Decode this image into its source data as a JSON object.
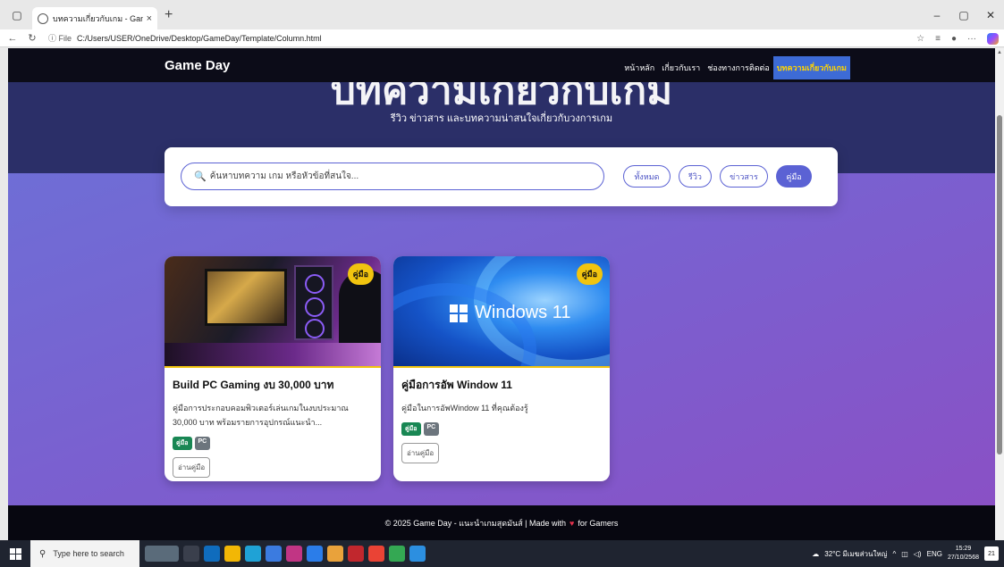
{
  "browser": {
    "tab_title": "บทความเกี่ยวกับเกม - Game Day",
    "tab_close": "×",
    "new_tab": "+",
    "address_prefix": "File",
    "url": "C:/Users/USER/OneDrive/Desktop/GameDay/Template/Column.html",
    "window_controls": [
      "–",
      "▢",
      "✕"
    ]
  },
  "navbar": {
    "brand": "Game Day",
    "links": [
      {
        "label": "หน้าหลัก"
      },
      {
        "label": "เกี่ยวกับเรา"
      },
      {
        "label": "ช่องทางการติดต่อ"
      },
      {
        "label": "บทความเกี่ยวกับเกม",
        "active": true
      }
    ]
  },
  "hero": {
    "title": "บทความเกี่ยวกับเกม",
    "subtitle": "รีวิว ข่าวสาร และบทความน่าสนใจเกี่ยวกับวงการเกม"
  },
  "search": {
    "placeholder": "ค้นหาบทความ เกม หรือหัวข้อที่สนใจ...",
    "filters": [
      {
        "label": "ทั้งหมด",
        "active": false
      },
      {
        "label": "รีวิว",
        "active": false
      },
      {
        "label": "ข่าวสาร",
        "active": false
      },
      {
        "label": "คู่มือ",
        "active": true
      }
    ]
  },
  "cards": [
    {
      "category": "คู่มือ",
      "title": "Build PC Gaming งบ 30,000 บาท",
      "description": "คู่มือการประกอบคอมพิวเตอร์เล่นเกมในงบประมาณ 30,000 บาท พร้อมรายการอุปกรณ์แนะนำ...",
      "tags": [
        "คู่มือ",
        "PC"
      ],
      "button": "อ่านคู่มือ"
    },
    {
      "category": "คู่มือ",
      "title": "คู่มือการอัพ Window 11",
      "description": "คู่มือในการอัพWindow 11 ที่คุณต้องรู้",
      "image_text": "Windows 11",
      "tags": [
        "คู่มือ",
        "PC"
      ],
      "button": "อ่านคู่มือ"
    }
  ],
  "footer": {
    "left": "© 2025 Game Day - แนะนำเกมสุดมันส์ | Made with",
    "heart": "♥",
    "right": "for Gamers"
  },
  "taskbar": {
    "search_placeholder": "Type here to search",
    "weather": "32°C มีเมฆส่วนใหญ่",
    "lang": "ENG",
    "time": "15:29",
    "date": "27/10/2568",
    "notifications": "21"
  },
  "colors": {
    "accent": "#5b62d4",
    "nav_active_bg": "#3d6bd6",
    "nav_active_text": "#ffd400",
    "badge": "#f1c40f",
    "tag_green": "#198754",
    "tag_gray": "#6c757d"
  }
}
